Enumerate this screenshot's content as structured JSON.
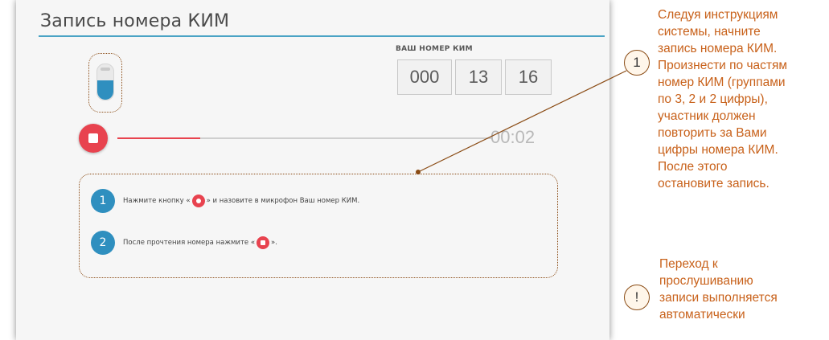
{
  "screen": {
    "title": "Запись номера КИМ",
    "accent_color": "#4aa3c5",
    "record_color": "#e8434f"
  },
  "microphone": {
    "icon": "microphone-icon",
    "level": 0.55
  },
  "kim": {
    "label": "ВАШ НОМЕР КИМ",
    "part1": "000",
    "part2": "13",
    "part3": "16"
  },
  "recorder": {
    "stop_icon": "stop-icon",
    "progress": 0.22,
    "timer": "00:02"
  },
  "instructions": {
    "steps": [
      {
        "number": "1",
        "text_before": "Нажмите кнопку «",
        "icon": "record-icon",
        "text_after": "» и назовите в микрофон Ваш номер КИМ."
      },
      {
        "number": "2",
        "text_before": "После прочтения номера нажмите «",
        "icon": "stop-icon",
        "text_after": "»."
      }
    ]
  },
  "annotations": {
    "callout1": {
      "marker": "1",
      "text_lines": [
        "Следуя инструкциям",
        "системы, начните",
        "запись номера КИМ.",
        "Произнести по частям",
        "номер КИМ (группами",
        "по 3, 2 и 2 цифры),",
        "участник должен",
        "повторить за Вами",
        "цифры номера КИМ.",
        "После этого",
        "остановите запись."
      ]
    },
    "callout2": {
      "marker": "!",
      "text_lines": [
        "Переход к",
        "прослушиванию",
        "записи выполняется",
        "автоматически"
      ]
    },
    "text_color": "#c8611a",
    "marker_color": "#8a4b14"
  }
}
